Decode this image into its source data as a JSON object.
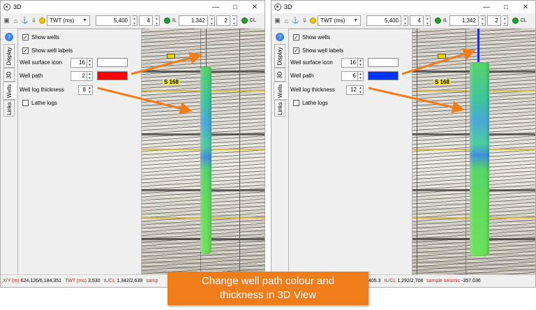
{
  "caption": "Change well path colour and\nthickness in 3D View",
  "windows": [
    {
      "title": "3D",
      "toolbar": {
        "domain": "TWT (ms)",
        "value1": "5,400",
        "spin1": "4",
        "il_label": "IL",
        "value2": "1,342",
        "spin2": "2",
        "cl_label": "CL"
      },
      "tabs": [
        "Display",
        "3D",
        "Wells",
        "Links"
      ],
      "active_tab": "Wells",
      "panel": {
        "show_wells": "Show wells",
        "show_well_labels": "Show well labels",
        "surface_icon_label": "Well surface icon",
        "surface_icon_value": "16",
        "well_path_label": "Well path",
        "well_path_value": "2",
        "well_path_color": "#ff0000",
        "log_thickness_label": "Well log thickness",
        "log_thickness_value": "8",
        "lathe_logs": "Lathe logs"
      },
      "well_label": "S 168",
      "status": {
        "xy_key": "X/Y (m)",
        "xy_val": "624,126/6,184,351",
        "twt_key": "TWT (ms)",
        "twt_val": "3,530",
        "ilcl_key": "IL/CL",
        "ilcl_val": "1,342/2,639",
        "sample_key": "samp",
        "sample_val": ""
      }
    },
    {
      "title": "3D",
      "toolbar": {
        "domain": "TWT (ms)",
        "value1": "5,400",
        "spin1": "4",
        "il_label": "IL",
        "value2": "1,342",
        "spin2": "2",
        "cl_label": "CL"
      },
      "tabs": [
        "Display",
        "3D",
        "Wells",
        "Links"
      ],
      "active_tab": "Wells",
      "panel": {
        "show_wells": "Show wells",
        "show_well_labels": "Show well labels",
        "surface_icon_label": "Well surface icon",
        "surface_icon_value": "16",
        "well_path_label": "Well path",
        "well_path_value": "6",
        "well_path_color": "#0033ff",
        "log_thickness_label": "Well log thickness",
        "log_thickness_value": "12",
        "lathe_logs": "Lathe logs"
      },
      "well_label": "S 168",
      "status": {
        "xy_key": "",
        "xy_val": "405.3",
        "twt_key": "",
        "twt_val": "",
        "ilcl_key": "IL/CL",
        "ilcl_val": "1,292/2,708",
        "sample_key": "sample seismic",
        "sample_val": "-357.036"
      }
    }
  ]
}
